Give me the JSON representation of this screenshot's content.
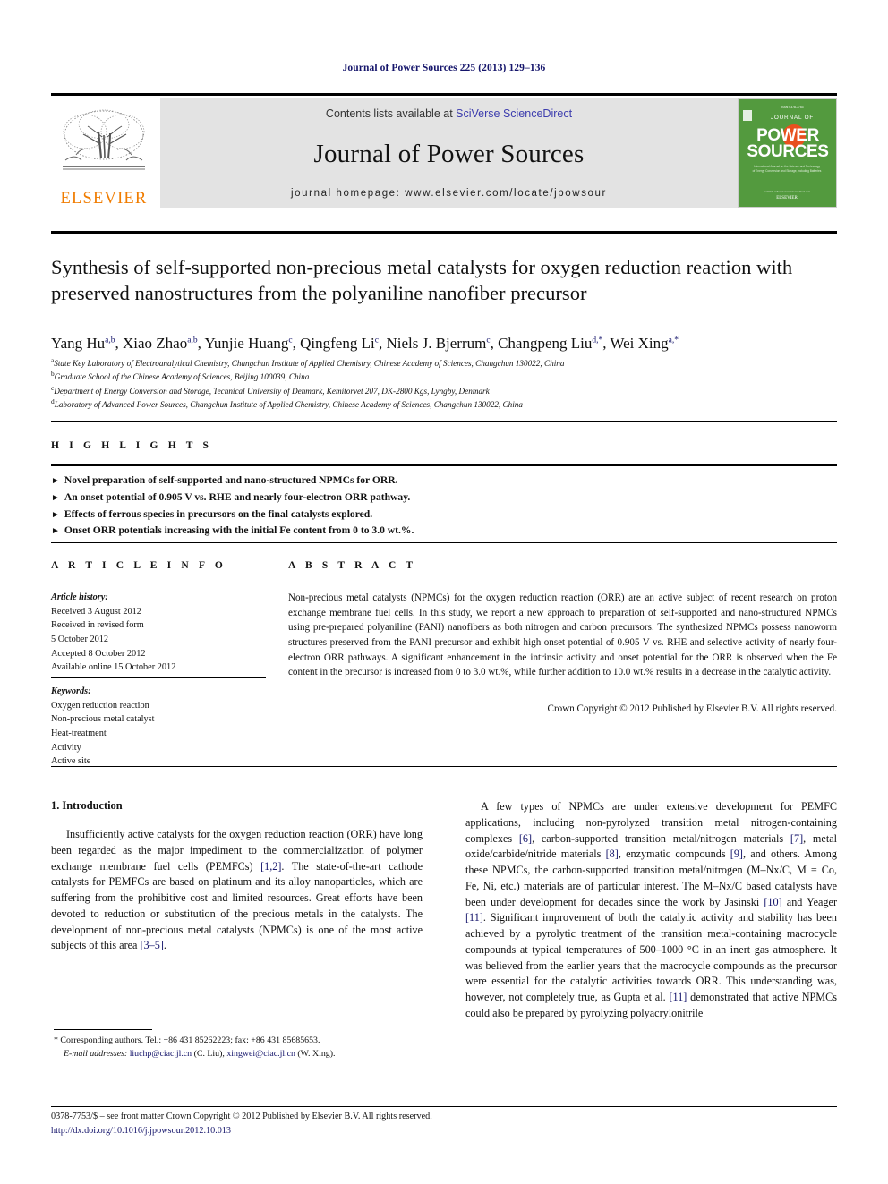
{
  "running_head": "Journal of Power Sources 225 (2013) 129–136",
  "masthead": {
    "contents_prefix": "Contents lists available at ",
    "contents_link": "SciVerse ScienceDirect",
    "journal_name": "Journal of Power Sources",
    "homepage_line": "journal homepage: www.elsevier.com/locate/jpowsour",
    "publisher_wordmark": "ELSEVIER",
    "cover": {
      "top_label": "JOURNAL OF",
      "title_line1": "POWER",
      "title_line2": "SOURCES",
      "subtitle": "International Journal on the Science and Technology of Energy Conversion and Storage, including Batteries, Fuel Cells and Photovoltaics",
      "footer": "ELSEVIER",
      "background_color": "#539a3e",
      "accent_color": "#e8501e"
    }
  },
  "article": {
    "title": "Synthesis of self-supported non-precious metal catalysts for oxygen reduction reaction with preserved nanostructures from the polyaniline nanofiber precursor",
    "authors": [
      {
        "name": "Yang Hu",
        "marks": "a,b",
        "sep": ", "
      },
      {
        "name": "Xiao Zhao",
        "marks": "a,b",
        "sep": ", "
      },
      {
        "name": "Yunjie Huang",
        "marks": "c",
        "sep": ", "
      },
      {
        "name": "Qingfeng Li",
        "marks": "c",
        "sep": ", "
      },
      {
        "name": "Niels J. Bjerrum",
        "marks": "c",
        "sep": ", "
      },
      {
        "name": "Changpeng Liu",
        "marks": "d,*",
        "sep": ", "
      },
      {
        "name": "Wei Xing",
        "marks": "a,*",
        "sep": ""
      }
    ],
    "affiliations": [
      {
        "mark": "a",
        "text": "State Key Laboratory of Electroanalytical Chemistry, Changchun Institute of Applied Chemistry, Chinese Academy of Sciences, Changchun 130022, China"
      },
      {
        "mark": "b",
        "text": "Graduate School of the Chinese Academy of Sciences, Beijing 100039, China"
      },
      {
        "mark": "c",
        "text": "Department of Energy Conversion and Storage, Technical University of Denmark, Kemitorvet 207, DK-2800 Kgs, Lyngby, Denmark"
      },
      {
        "mark": "d",
        "text": "Laboratory of Advanced Power Sources, Changchun Institute of Applied Chemistry, Chinese Academy of Sciences, Changchun 130022, China"
      }
    ]
  },
  "highlights": {
    "label": "H I G H L I G H T S",
    "items": [
      "Novel preparation of self-supported and nano-structured NPMCs for ORR.",
      "An onset potential of 0.905 V vs. RHE and nearly four-electron ORR pathway.",
      "Effects of ferrous species in precursors on the final catalysts explored.",
      "Onset ORR potentials increasing with the initial Fe content from 0 to 3.0 wt.%."
    ]
  },
  "article_info": {
    "label": "A R T I C L E   I N F O",
    "history_heading": "Article history:",
    "history": [
      "Received 3 August 2012",
      "Received in revised form",
      "5 October 2012",
      "Accepted 8 October 2012",
      "Available online 15 October 2012"
    ],
    "keywords_heading": "Keywords:",
    "keywords": [
      "Oxygen reduction reaction",
      "Non-precious metal catalyst",
      "Heat-treatment",
      "Activity",
      "Active site"
    ]
  },
  "abstract": {
    "label": "A B S T R A C T",
    "text": "Non-precious metal catalysts (NPMCs) for the oxygen reduction reaction (ORR) are an active subject of recent research on proton exchange membrane fuel cells. In this study, we report a new approach to preparation of self-supported and nano-structured NPMCs using pre-prepared polyaniline (PANI) nanofibers as both nitrogen and carbon precursors. The synthesized NPMCs possess nanoworm structures preserved from the PANI precursor and exhibit high onset potential of 0.905 V vs. RHE and selective activity of nearly four-electron ORR pathways. A significant enhancement in the intrinsic activity and onset potential for the ORR is observed when the Fe content in the precursor is increased from 0 to 3.0 wt.%, while further addition to 10.0 wt.% results in a decrease in the catalytic activity.",
    "copyright": "Crown Copyright © 2012 Published by Elsevier B.V. All rights reserved."
  },
  "introduction": {
    "heading": "1.  Introduction",
    "left_paragraph_parts": [
      {
        "t": "Insufficiently active catalysts for the oxygen reduction reaction (ORR) have long been regarded as the major impediment to the commercialization of polymer exchange membrane fuel cells (PEMFCs) ",
        "ref": false
      },
      {
        "t": "[1,2]",
        "ref": true
      },
      {
        "t": ". The state-of-the-art cathode catalysts for PEMFCs are based on platinum and its alloy nanoparticles, which are suffering from the prohibitive cost and limited resources. Great efforts have been devoted to reduction or substitution of the precious metals in the catalysts. The development of non-precious metal catalysts (NPMCs) is one of the most active subjects of this area ",
        "ref": false
      },
      {
        "t": "[3–5]",
        "ref": true
      },
      {
        "t": ".",
        "ref": false
      }
    ],
    "right_paragraph_parts": [
      {
        "t": "A few types of NPMCs are under extensive development for PEMFC applications, including non-pyrolyzed transition metal nitrogen-containing complexes ",
        "ref": false
      },
      {
        "t": "[6]",
        "ref": true
      },
      {
        "t": ", carbon-supported transition metal/nitrogen materials ",
        "ref": false
      },
      {
        "t": "[7]",
        "ref": true
      },
      {
        "t": ", metal oxide/carbide/nitride materials ",
        "ref": false
      },
      {
        "t": "[8]",
        "ref": true
      },
      {
        "t": ", enzymatic compounds ",
        "ref": false
      },
      {
        "t": "[9]",
        "ref": true
      },
      {
        "t": ", and others. Among these NPMCs, the carbon-supported transition metal/nitrogen (M–Nx/C, M = Co, Fe, Ni, etc.) materials are of particular interest. The M–Nx/C based catalysts have been under development for decades since the work by Jasinski ",
        "ref": false
      },
      {
        "t": "[10]",
        "ref": true
      },
      {
        "t": " and Yeager ",
        "ref": false
      },
      {
        "t": "[11]",
        "ref": true
      },
      {
        "t": ". Significant improvement of both the catalytic activity and stability has been achieved by a pyrolytic treatment of the transition metal-containing macrocycle compounds at typical temperatures of 500–1000 °C in an inert gas atmosphere. It was believed from the earlier years that the macrocycle compounds as the precursor were essential for the catalytic activities towards ORR. This understanding was, however, not completely true, as Gupta et al. ",
        "ref": false
      },
      {
        "t": "[11]",
        "ref": true
      },
      {
        "t": " demonstrated that active NPMCs could also be prepared by pyrolyzing polyacrylonitrile",
        "ref": false
      }
    ]
  },
  "footnote": {
    "corresponding": "* Corresponding authors. Tel.: +86 431 85262223; fax: +86 431 85685653.",
    "email_label": "E-mail addresses:",
    "email1": "liuchp@ciac.jl.cn",
    "email1_owner": "(C. Liu),",
    "email2": "xingwei@ciac.jl.cn",
    "email2_owner": "(W. Xing)."
  },
  "bottom": {
    "issn_line": "0378-7753/$ – see front matter Crown Copyright © 2012 Published by Elsevier B.V. All rights reserved.",
    "doi": "http://dx.doi.org/10.1016/j.jpowsour.2012.10.013"
  }
}
